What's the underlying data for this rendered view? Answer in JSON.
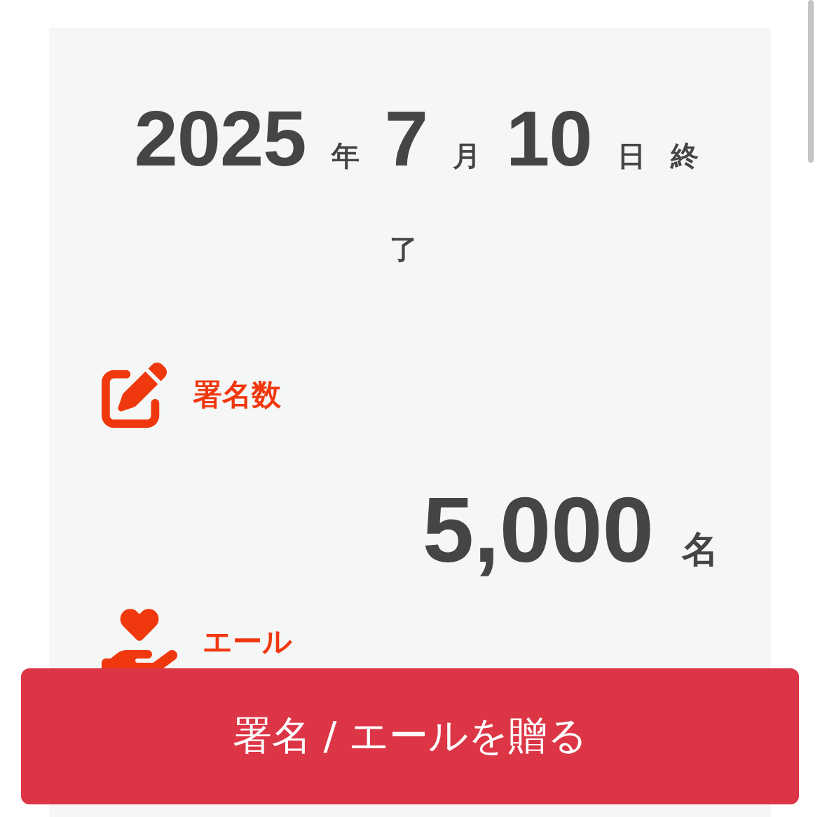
{
  "deadline": {
    "year": "2025",
    "year_unit": "年",
    "month": "7",
    "month_unit": "月",
    "day": "10",
    "day_unit": "日",
    "suffix": "終了"
  },
  "signatures": {
    "label": "署名数",
    "count": "5,000",
    "unit": "名"
  },
  "cheers": {
    "label": "エール"
  },
  "button": {
    "label": "署名 / エールを贈る"
  }
}
